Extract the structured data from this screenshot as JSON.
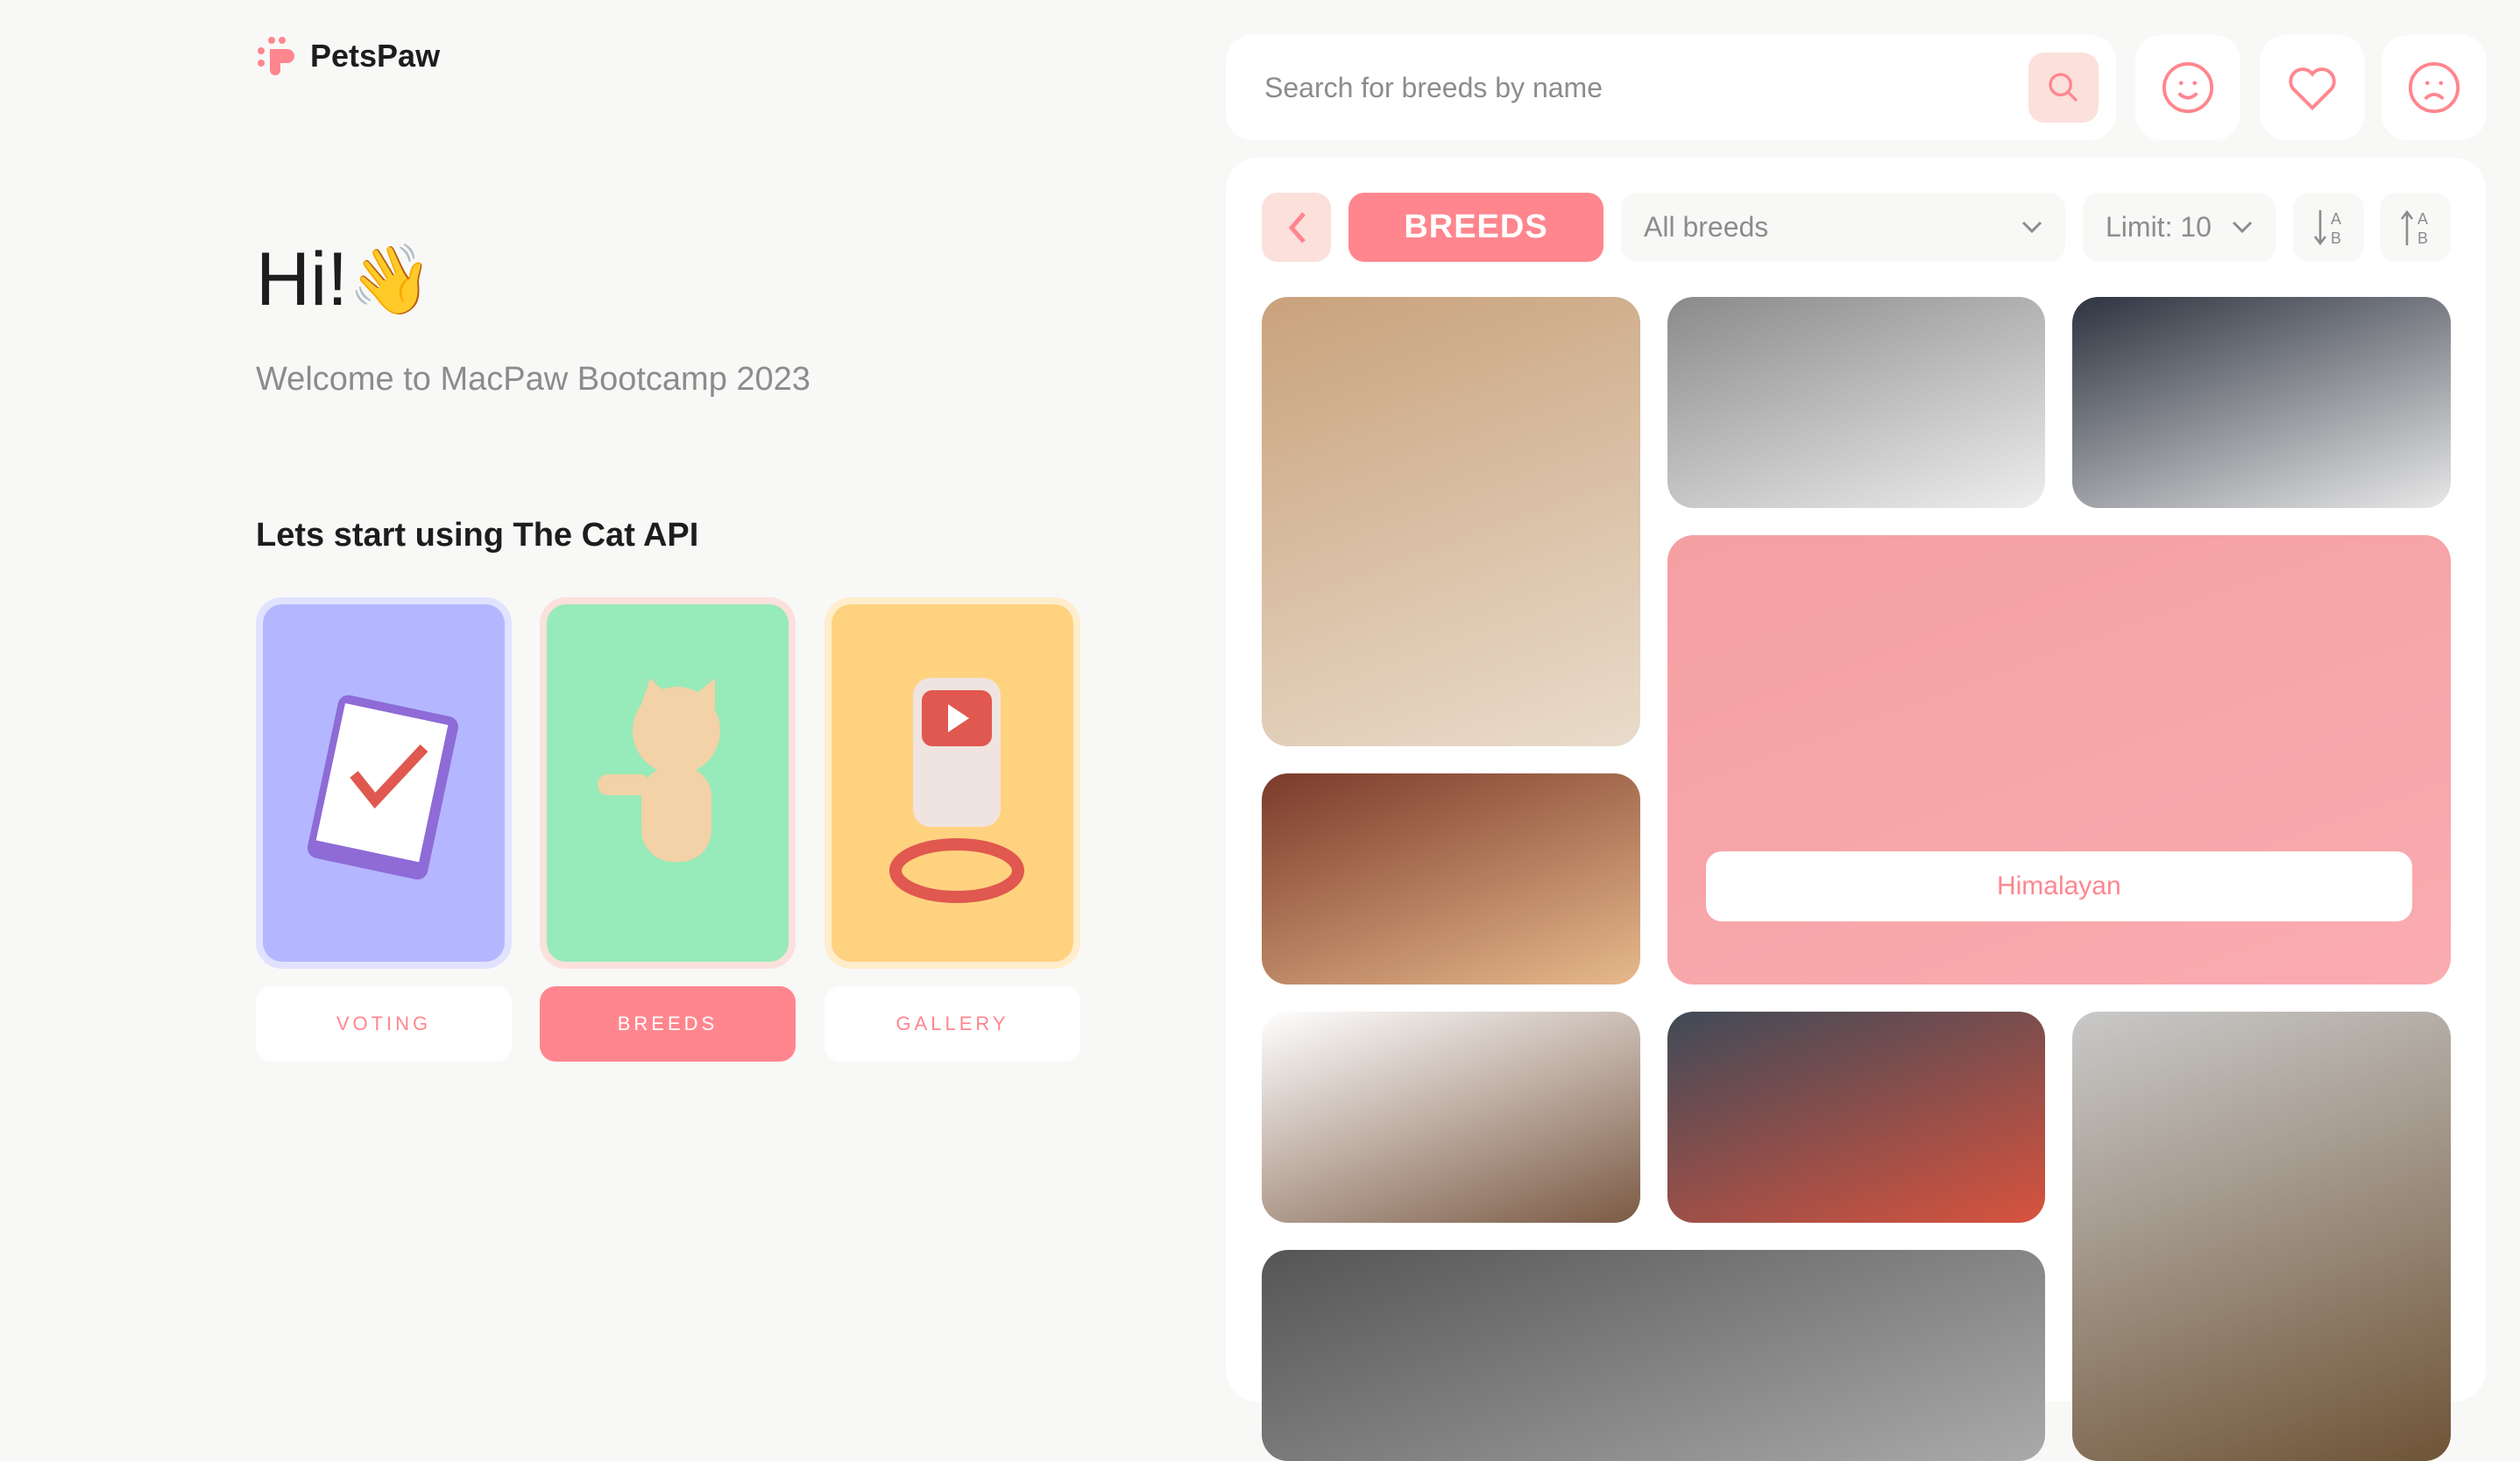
{
  "app": {
    "name": "PetsPaw"
  },
  "intro": {
    "greeting": "Hi!",
    "wave": "👋",
    "welcome": "Welcome to MacPaw Bootcamp 2023",
    "start": "Lets start using The Cat API"
  },
  "nav": [
    {
      "label": "VOTING",
      "color": "#B4B7FF"
    },
    {
      "label": "BREEDS",
      "color": "#97EAB9"
    },
    {
      "label": "GALLERY",
      "color": "#FFD280"
    }
  ],
  "search": {
    "placeholder": "Search for breeds by name"
  },
  "toolbar": {
    "section": "BREEDS",
    "breed_select": "All breeds",
    "limit_select": "Limit: 10"
  },
  "grid": [
    {
      "id": "cat-1",
      "colors": [
        "#c9a27c",
        "#e9dccb"
      ]
    },
    {
      "id": "cat-2",
      "colors": [
        "#8a8a8a",
        "#eeeeee"
      ]
    },
    {
      "id": "cat-3",
      "colors": [
        "#2d3340",
        "#e8e8e8"
      ]
    },
    {
      "id": "cat-4",
      "colors": [
        "#e3c6c3",
        "#f3e4e2"
      ],
      "label": "Himalayan"
    },
    {
      "id": "cat-5",
      "colors": [
        "#7a3a2a",
        "#e7b98c"
      ]
    },
    {
      "id": "cat-6",
      "colors": [
        "#ffffff",
        "#7b5a44"
      ]
    },
    {
      "id": "cat-7",
      "colors": [
        "#3f4a58",
        "#d8533e"
      ]
    },
    {
      "id": "cat-8",
      "colors": [
        "#c9c9c9",
        "#6f5436"
      ]
    },
    {
      "id": "cat-9",
      "colors": [
        "#555",
        "#aaa"
      ]
    }
  ],
  "colors": {
    "accent": "#FF868E",
    "accent_light": "#FBE0DC",
    "bg": "#F8F8F7"
  }
}
